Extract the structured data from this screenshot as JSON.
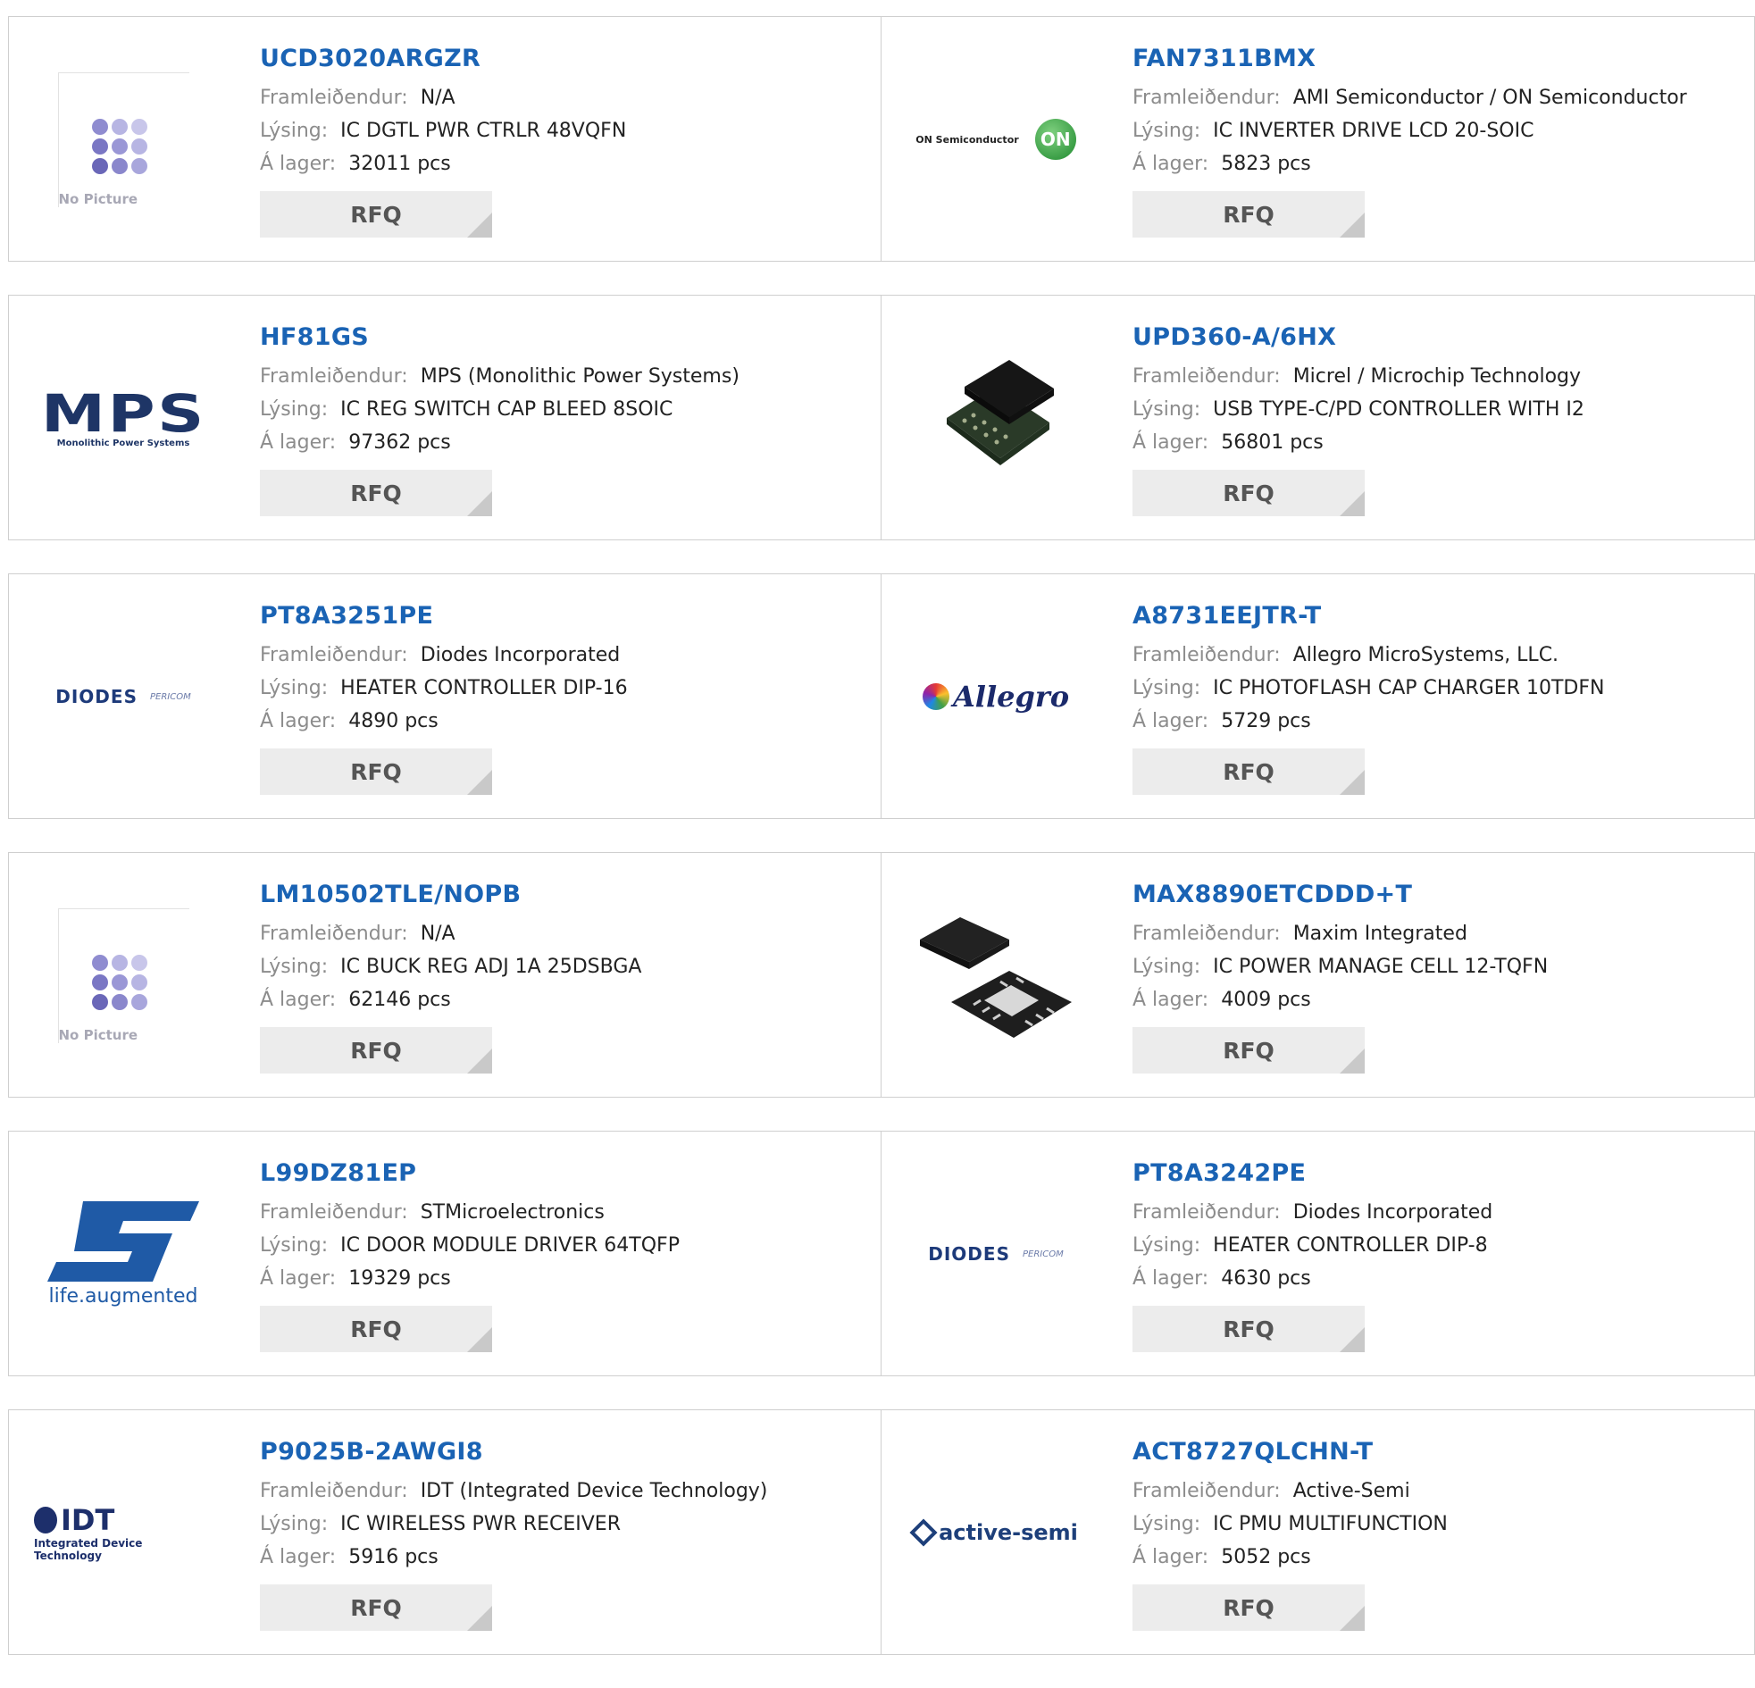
{
  "labels": {
    "manufacturer": "Framleiðendur:",
    "description": "Lýsing:",
    "stock": "Á lager:",
    "rfq": "RFQ",
    "no_picture": "No Picture"
  },
  "products": [
    {
      "pn": "UCD3020ARGZR",
      "manufacturer": "N/A",
      "description": "IC DGTL PWR CTRLR 48VQFN",
      "stock": "32011 pcs",
      "logo": "no-picture"
    },
    {
      "pn": "FAN7311BMX",
      "manufacturer": "AMI Semiconductor / ON Semiconductor",
      "description": "IC INVERTER DRIVE LCD 20-SOIC",
      "stock": "5823 pcs",
      "logo": "on-semiconductor-logo",
      "logo_text": "ON Semiconductor",
      "logo_mark": "ON"
    },
    {
      "pn": "HF81GS",
      "manufacturer": "MPS (Monolithic Power Systems)",
      "description": "IC REG SWITCH CAP BLEED 8SOIC",
      "stock": "97362 pcs",
      "logo": "mps-logo",
      "logo_text": "MPS",
      "logo_sub": "Monolithic Power Systems"
    },
    {
      "pn": "UPD360-A/6HX",
      "manufacturer": "Micrel / Microchip Technology",
      "description": "USB TYPE-C/PD CONTROLLER WITH I2",
      "stock": "56801 pcs",
      "logo": "chip-photo"
    },
    {
      "pn": "PT8A3251PE",
      "manufacturer": "Diodes Incorporated",
      "description": "HEATER CONTROLLER DIP-16",
      "stock": "4890 pcs",
      "logo": "diodes-logo",
      "logo_text": "DIODES",
      "logo_sub": "PERICOM"
    },
    {
      "pn": "A8731EEJTR-T",
      "manufacturer": "Allegro MicroSystems, LLC.",
      "description": "IC PHOTOFLASH CAP CHARGER 10TDFN",
      "stock": "5729 pcs",
      "logo": "allegro-logo",
      "logo_text": "Allegro"
    },
    {
      "pn": "LM10502TLE/NOPB",
      "manufacturer": "N/A",
      "description": "IC BUCK REG ADJ 1A 25DSBGA",
      "stock": "62146 pcs",
      "logo": "no-picture"
    },
    {
      "pn": "MAX8890ETCDDD+T",
      "manufacturer": "Maxim Integrated",
      "description": "IC POWER MANAGE CELL 12-TQFN",
      "stock": "4009 pcs",
      "logo": "qfn-photo"
    },
    {
      "pn": "L99DZ81EP",
      "manufacturer": "STMicroelectronics",
      "description": "IC DOOR MODULE DRIVER 64TQFP",
      "stock": "19329 pcs",
      "logo": "st-logo",
      "logo_text": "life.augmented"
    },
    {
      "pn": "PT8A3242PE",
      "manufacturer": "Diodes Incorporated",
      "description": "HEATER CONTROLLER DIP-8",
      "stock": "4630 pcs",
      "logo": "diodes-logo",
      "logo_text": "DIODES",
      "logo_sub": "PERICOM"
    },
    {
      "pn": "P9025B-2AWGI8",
      "manufacturer": "IDT (Integrated Device Technology)",
      "description": "IC WIRELESS PWR RECEIVER",
      "stock": "5916 pcs",
      "logo": "idt-logo",
      "logo_text": "IDT",
      "logo_sub": "Integrated Device Technology"
    },
    {
      "pn": "ACT8727QLCHN-T",
      "manufacturer": "Active-Semi",
      "description": "IC PMU MULTIFUNCTION",
      "stock": "5052 pcs",
      "logo": "active-semi-logo",
      "logo_text": "active-semi"
    }
  ]
}
